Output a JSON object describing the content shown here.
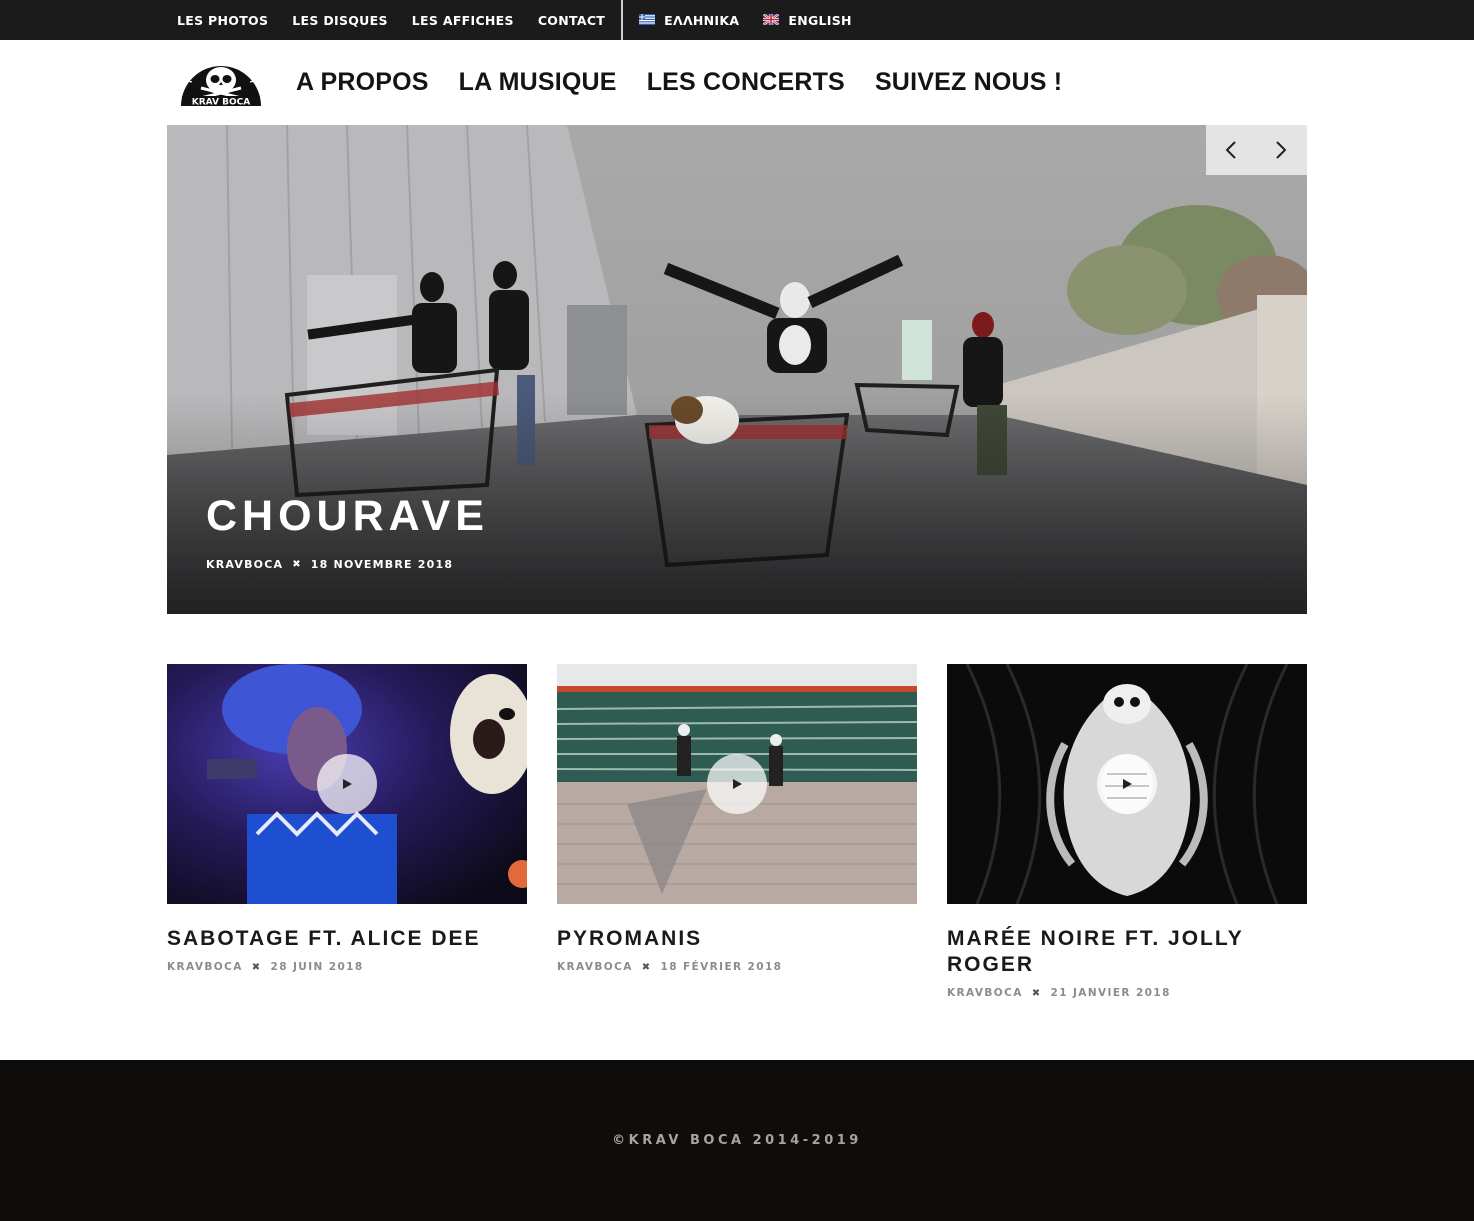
{
  "topbar": {
    "links": [
      "LES PHOTOS",
      "LES DISQUES",
      "LES AFFICHES",
      "CONTACT"
    ],
    "languages": [
      {
        "label": "ΕΛΛΗΝΙΚΑ",
        "flag": "greece-flag-icon"
      },
      {
        "label": "ENGLISH",
        "flag": "uk-flag-icon"
      }
    ]
  },
  "header": {
    "logo_text": "KRAV BOCA",
    "nav": [
      "A PROPOS",
      "LA MUSIQUE",
      "LES CONCERTS",
      "SUIVEZ NOUS !"
    ]
  },
  "hero": {
    "title": "CHOURAVE",
    "author": "KRAVBOCA",
    "date": "18 NOVEMBRE 2018",
    "prev_icon": "chevron-left-icon",
    "next_icon": "chevron-right-icon"
  },
  "posts": [
    {
      "title": "SABOTAGE FT. ALICE DEE",
      "author": "KRAVBOCA",
      "date": "28 JUIN 2018"
    },
    {
      "title": "PYROMANIS",
      "author": "KRAVBOCA",
      "date": "18 FÉVRIER 2018"
    },
    {
      "title": "MARÉE NOIRE FT. JOLLY ROGER",
      "author": "KRAVBOCA",
      "date": "21 JANVIER 2018"
    }
  ],
  "meta_separator": "✖",
  "footer": {
    "copyright": "©KRAV BOCA 2014-2019"
  },
  "colors": {
    "topbar_bg": "#1b1b1b",
    "footer_bg": "#0e0d0c",
    "footer_text": "#a8a39b",
    "meta_text": "#8c8c8c"
  }
}
